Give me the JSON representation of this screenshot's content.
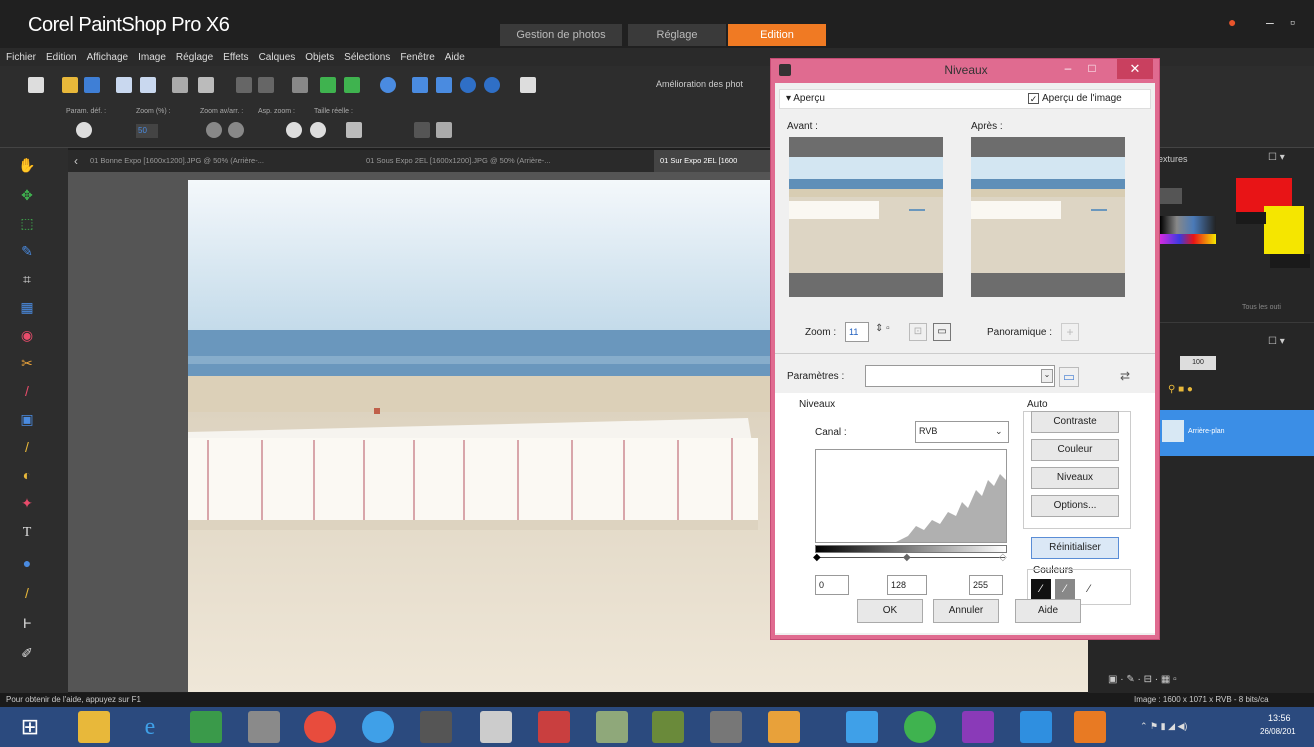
{
  "app": {
    "title": "Corel PaintShop Pro X6",
    "workspace_tabs": [
      "Gestion de photos",
      "Réglage",
      "Edition"
    ],
    "active_tab": "Edition",
    "accent": "#f07a23"
  },
  "menu": [
    "Fichier",
    "Edition",
    "Affichage",
    "Image",
    "Réglage",
    "Effets",
    "Calques",
    "Objets",
    "Sélections",
    "Fenêtre",
    "Aide"
  ],
  "toolbar": {
    "enhance_label": "Amélioration des phot",
    "options": [
      "Param. déf. :",
      "Zoom (%) :",
      "Zoom av/arr. :",
      "Asp. zoom :",
      "Taille réelle :"
    ],
    "zoom_value": "50"
  },
  "doc_tabs": [
    "01 Bonne Expo [1600x1200].JPG @ 50% (Arrière-...",
    "01 Sous Expo 2EL [1600x1200].JPG @ 50% (Arrière-...",
    "01 Sur Expo 2EL [1600"
  ],
  "right_panel": {
    "materials_label": "extures",
    "all_tools_label": "Tous les outi",
    "layer_opacity": "100",
    "layer_name": "Arrière-plan",
    "primary_color": "#e81416",
    "secondary_color": "#f5e600",
    "layer_highlight": "#3b8ee6"
  },
  "dialog": {
    "title": "Niveaux",
    "apercu_label": "Aperçu",
    "apercu_image_label": "Aperçu de l'image",
    "apercu_checked": true,
    "avant_label": "Avant :",
    "apres_label": "Après :",
    "zoom_label": "Zoom :",
    "zoom_value": "11",
    "panoramique_label": "Panoramique :",
    "parametres_label": "Paramètres :",
    "parametres_value": "",
    "niveaux_group": "Niveaux",
    "canal_label": "Canal :",
    "canal_value": "RVB",
    "auto_group": "Auto",
    "btn_contraste": "Contraste",
    "btn_couleur": "Couleur",
    "btn_niveaux": "Niveaux",
    "btn_options": "Options...",
    "btn_reinit": "Réinitialiser",
    "couleurs_label": "Couleurs",
    "input_low": "0",
    "input_mid": "128",
    "input_high": "255",
    "btn_ok": "OK",
    "btn_annuler": "Annuler",
    "btn_aide": "Aide",
    "frame_color": "#e06b90"
  },
  "status": {
    "left": "Pour obtenir de l'aide, appuyez sur F1",
    "right": "Image : 1600 x 1071 x RVB - 8 bits/ca"
  },
  "taskbar": {
    "time": "13:56",
    "date": "26/08/201"
  }
}
